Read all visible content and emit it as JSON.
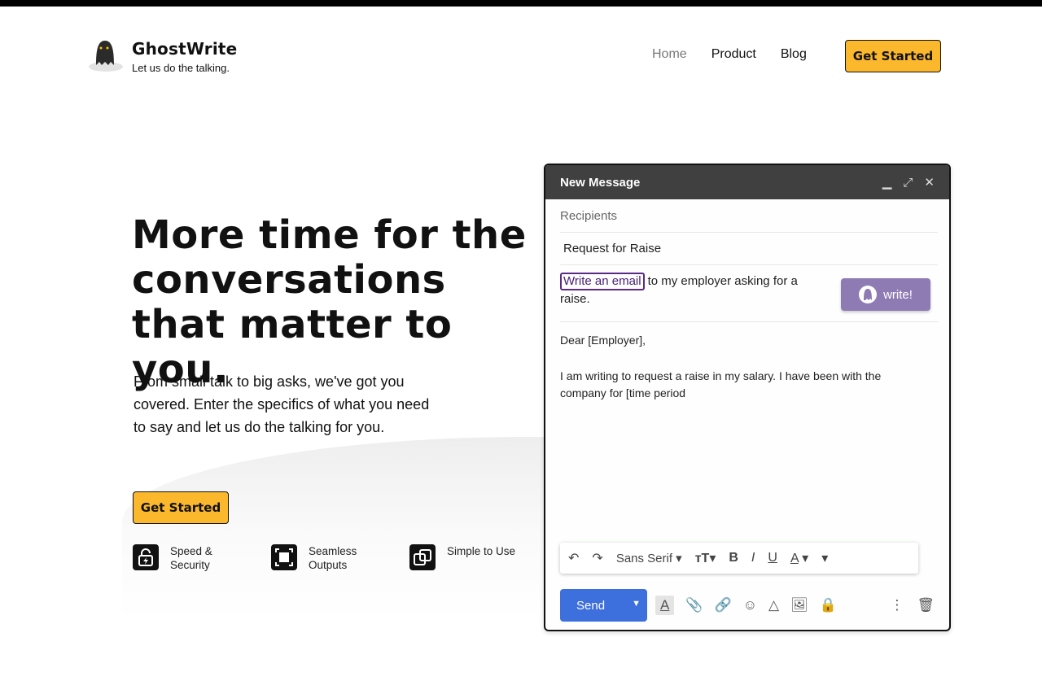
{
  "brand": {
    "name": "GhostWrite",
    "tagline": "Let us do the talking."
  },
  "nav": {
    "items": [
      {
        "label": "Home"
      },
      {
        "label": "Product"
      },
      {
        "label": "Blog"
      }
    ],
    "cta": "Get Started"
  },
  "hero": {
    "title": "More time for the conversations that matter to you.",
    "subtitle": "From small talk to big asks, we've got you covered. Enter the specifics of what you need to say and let us do the talking for you.",
    "cta": "Get Started"
  },
  "features": [
    {
      "label": "Speed & Security",
      "icon": "lock-bolt-icon"
    },
    {
      "label": "Seamless Outputs",
      "icon": "square-frame-icon"
    },
    {
      "label": "Simple to Use",
      "icon": "overlap-squares-icon"
    }
  ],
  "compose": {
    "title": "New Message",
    "recipients_placeholder": "Recipients",
    "subject": "Request for Raise",
    "prompt_highlight": "Write an email",
    "prompt_rest": "to my employer asking for a raise.",
    "write_button": "write!",
    "body_line1": "Dear [Employer],",
    "body_line2": "I am writing to request a raise in my salary. I have been with the company for [time period",
    "font_name": "Sans Serif",
    "send_label": "Send"
  }
}
